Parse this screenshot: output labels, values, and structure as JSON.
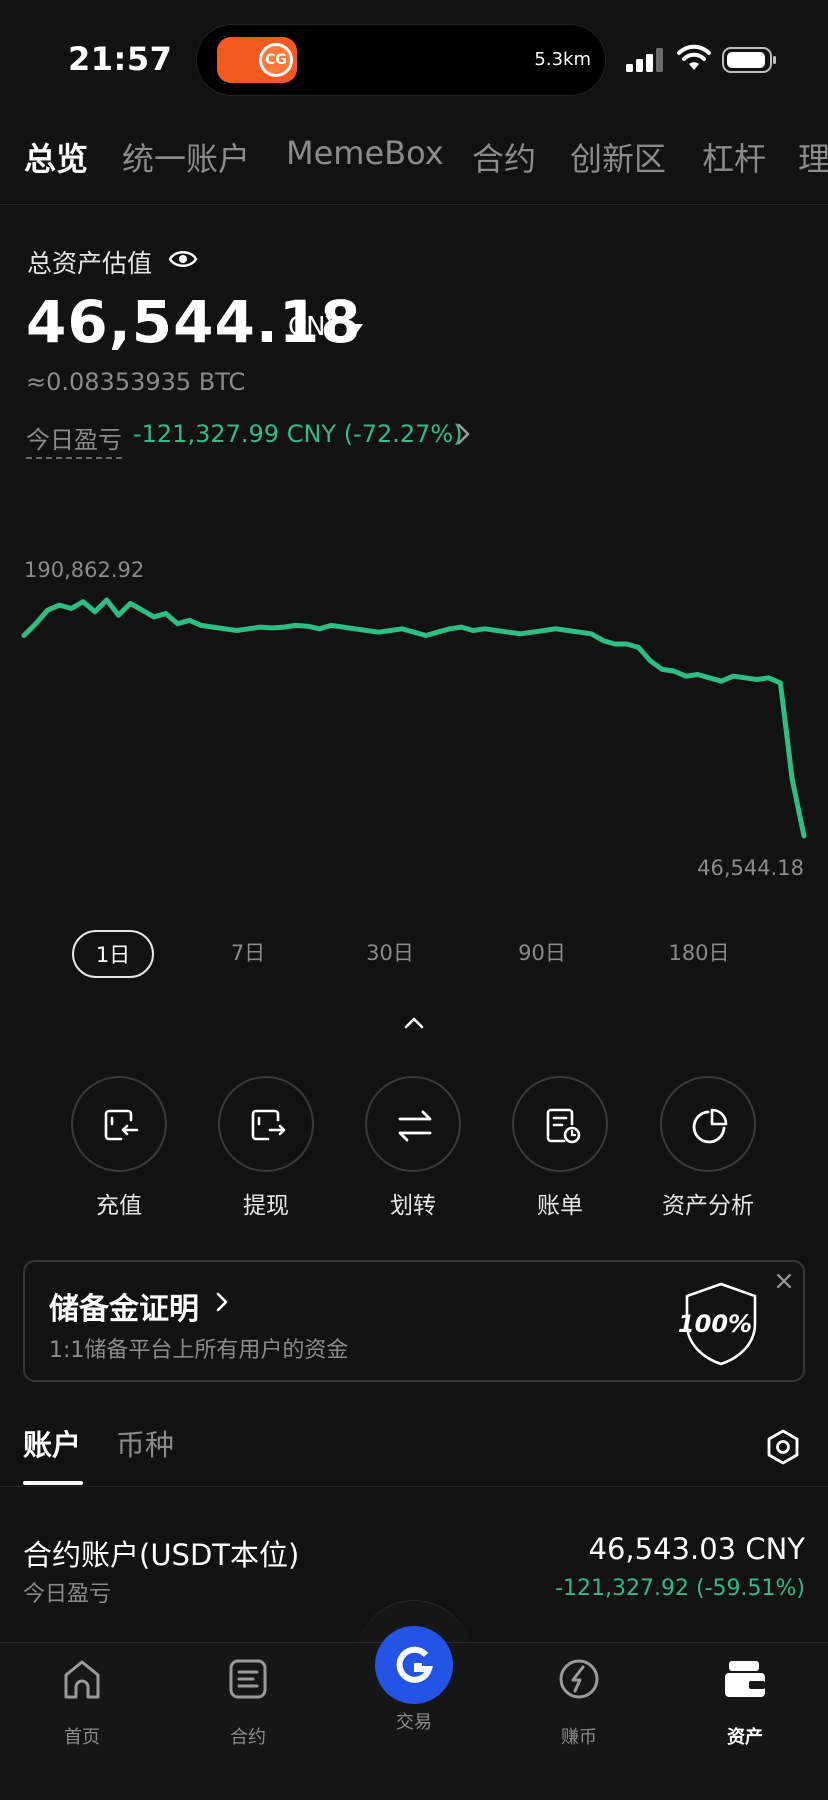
{
  "status_bar": {
    "time": "21:57",
    "distance": "5.3km",
    "island_badge": "CG"
  },
  "top_tabs": [
    "总览",
    "统一账户",
    "MemeBox",
    "合约",
    "创新区",
    "杠杆",
    "理"
  ],
  "asset": {
    "label": "总资产估值",
    "value": "46,544.18",
    "currency": "CNY",
    "btc": "≈0.08353935  BTC",
    "pnl_label": "今日盈亏",
    "pnl_value": "-121,327.99 CNY (-72.27%)"
  },
  "chart_data": {
    "type": "line",
    "max_label": "190,862.92",
    "min_label": "46,544.18",
    "series": [
      {
        "values": [
          165000,
          172000,
          180000,
          183000,
          181000,
          185000,
          179000,
          186000,
          177000,
          184000,
          180000,
          176000,
          178000,
          172000,
          174000,
          171000,
          170000,
          169000,
          168000,
          169000,
          170000,
          169500,
          170000,
          171000,
          170500,
          169000,
          171000,
          170000,
          169000,
          168000,
          167000,
          168000,
          169000,
          167000,
          165000,
          167000,
          169000,
          170000,
          168000,
          169000,
          168000,
          167000,
          166000,
          167000,
          168000,
          169000,
          168000,
          167000,
          166000,
          162000,
          160000,
          160000,
          158000,
          150000,
          145000,
          144000,
          141000,
          142000,
          140000,
          138000,
          141000,
          140000,
          139000,
          140000,
          137000,
          80000,
          46544
        ]
      }
    ],
    "color": "#2ebd85"
  },
  "range_tabs": [
    "1日",
    "7日",
    "30日",
    "90日",
    "180日"
  ],
  "actions": [
    {
      "label": "充值",
      "icon": "deposit-icon"
    },
    {
      "label": "提现",
      "icon": "withdraw-icon"
    },
    {
      "label": "划转",
      "icon": "transfer-icon"
    },
    {
      "label": "账单",
      "icon": "bill-icon"
    },
    {
      "label": "资产分析",
      "icon": "pie-chart-icon"
    }
  ],
  "reserve": {
    "title": "储备金证明",
    "subtitle": "1:1储备平台上所有用户的资金",
    "badge": "100%"
  },
  "account_tabs": [
    "账户",
    "币种"
  ],
  "accounts": [
    {
      "title": "合约账户(USDT本位)",
      "sub": "今日盈亏",
      "value": "46,543.03 CNY",
      "pnl": "-121,327.92 (-59.51%)"
    }
  ],
  "bottom_nav": [
    "首页",
    "合约",
    "交易",
    "赚币",
    "资产"
  ],
  "colors": {
    "accent_green": "#2ebd85",
    "trade_blue": "#2354e6",
    "background": "#121212"
  }
}
